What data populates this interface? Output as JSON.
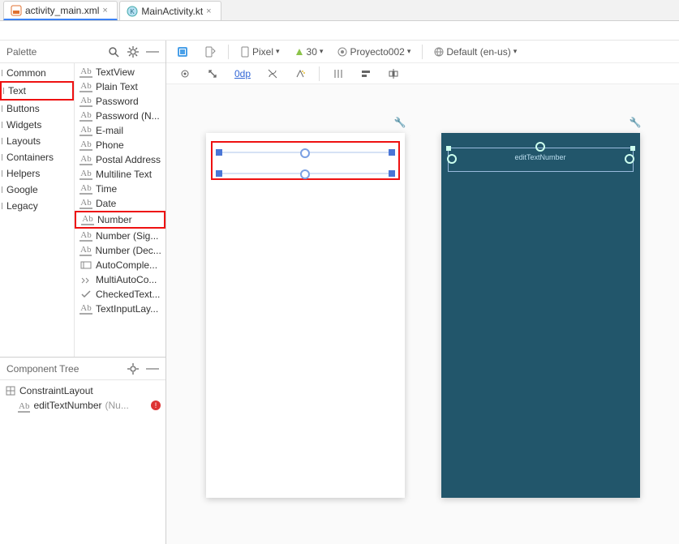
{
  "tabs": {
    "file1": "activity_main.xml",
    "file2": "MainActivity.kt"
  },
  "palette": {
    "title": "Palette",
    "categories": [
      "Common",
      "Text",
      "Buttons",
      "Widgets",
      "Layouts",
      "Containers",
      "Helpers",
      "Google",
      "Legacy"
    ],
    "selected_category_index": 1,
    "items": [
      "TextView",
      "Plain Text",
      "Password",
      "Password (N...",
      "E-mail",
      "Phone",
      "Postal Address",
      "Multiline Text",
      "Time",
      "Date",
      "Number",
      "Number (Sig...",
      "Number (Dec...",
      "AutoComple...",
      "MultiAutoCo...",
      "CheckedText...",
      "TextInputLay..."
    ],
    "highlighted_item_index": 10
  },
  "component_tree": {
    "title": "Component Tree",
    "root": "ConstraintLayout",
    "child": "editTextNumber",
    "child_hint": "(Nu...",
    "has_error": true
  },
  "toolbar": {
    "device": "Pixel",
    "api": "30",
    "project": "Proyecto002",
    "locale": "Default (en-us)",
    "margin_value": "0dp"
  },
  "blueprint": {
    "hint": "editTextNumber"
  }
}
